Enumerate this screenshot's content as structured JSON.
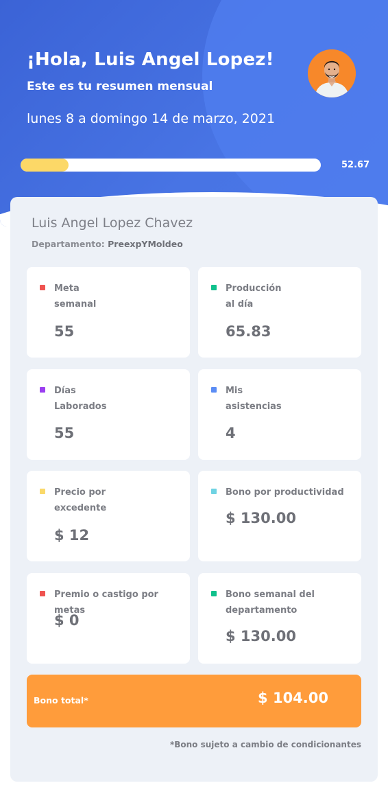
{
  "header": {
    "greeting": "¡Hola, Luis Angel Lopez!",
    "subtitle": "Este es tu resumen mensual",
    "date_range": "lunes 8 a domingo 14 de marzo, 2021",
    "progress_value": "52.67",
    "progress_fraction": 0.16,
    "avatar_icon": "user-avatar-photo",
    "accent_color": "#4874e4"
  },
  "employee": {
    "name": "Luis Angel Lopez Chavez",
    "department_label": "Departamento:",
    "department_value": "PreexpYMoldeo"
  },
  "cards": [
    {
      "label_line1": "Meta",
      "label_line2": "semanal",
      "value": "55",
      "color": "#ef5350"
    },
    {
      "label_line1": "Producción",
      "label_line2": "al día",
      "value": "65.83",
      "color": "#10c18c"
    },
    {
      "label_line1": "Días",
      "label_line2": "Laborados",
      "value": "55",
      "color": "#9b3ff0"
    },
    {
      "label_line1": "Mis",
      "label_line2": "asistencias",
      "value": "4",
      "color": "#5b8df5"
    },
    {
      "label_line1": "Precio por",
      "label_line2": "excedente",
      "value": "$ 12",
      "color": "#fad96a"
    },
    {
      "label_line1": "Bono por productividad",
      "label_line2": "",
      "value": "$ 130.00",
      "color": "#6fd3e3"
    },
    {
      "label_line1": "Premio o castigo por metas",
      "label_line2": "",
      "value": "$ 0",
      "color": "#ef5350"
    },
    {
      "label_line1": "Bono semanal del",
      "label_line2": "departamento",
      "value": "$ 130.00",
      "color": "#10c18c"
    }
  ],
  "total": {
    "label": "Bono total*",
    "value": "$ 104.00",
    "color": "#ff9c3b"
  },
  "footnote": "*Bono sujeto a cambio de condicionantes"
}
